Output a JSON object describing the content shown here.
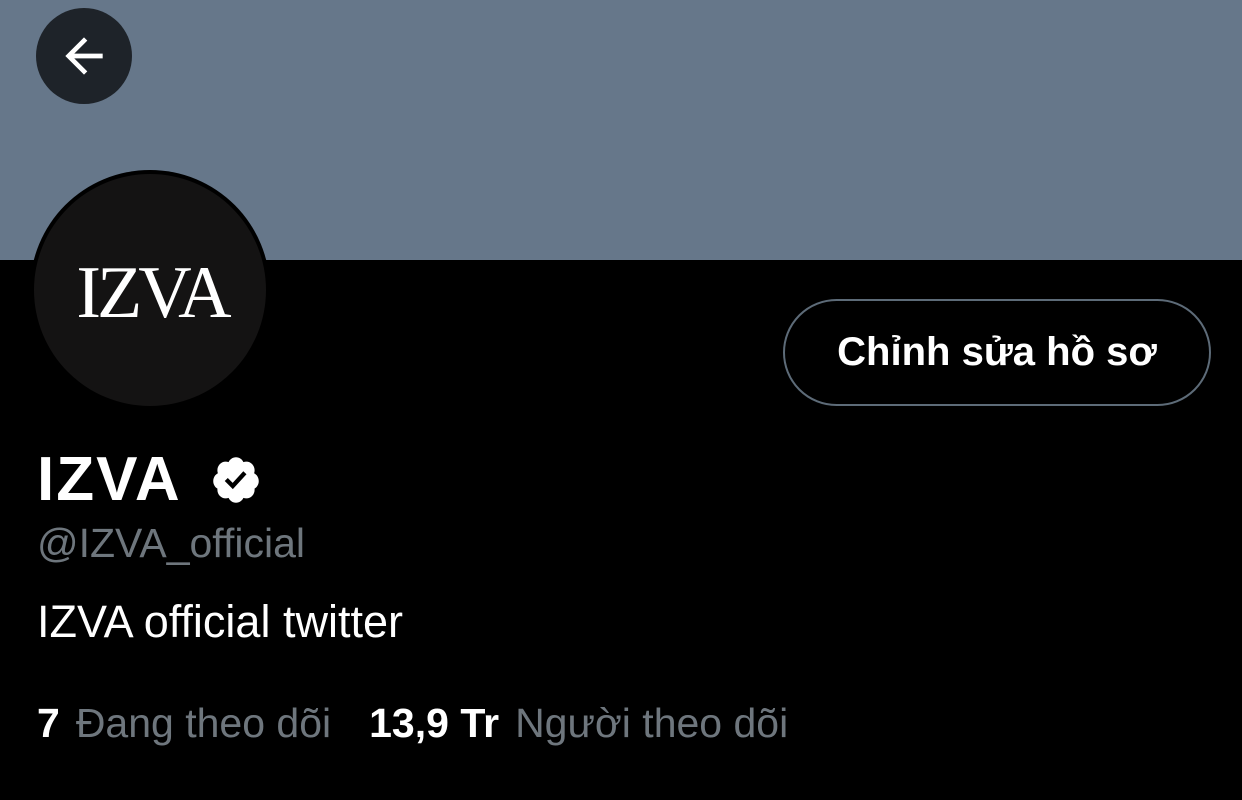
{
  "colors": {
    "banner": "#66778a",
    "background": "#000000",
    "text_primary": "#ffffff",
    "text_secondary": "#6e767d",
    "button_border": "#5d6b78",
    "back_button_bg": "#1e2329"
  },
  "header": {
    "back_icon": "arrow-left-icon"
  },
  "profile": {
    "avatar_logo_text": "IZVA",
    "edit_button_label": "Chỉnh sửa hồ sơ",
    "display_name": "IZVA",
    "verified_icon": "verified-badge-icon",
    "handle": "@IZVA_official",
    "bio": "IZVA official twitter",
    "stats": {
      "following_count": "7",
      "following_label": "Đang theo dõi",
      "followers_count": "13,9 Tr",
      "followers_label": "Người theo dõi"
    }
  }
}
